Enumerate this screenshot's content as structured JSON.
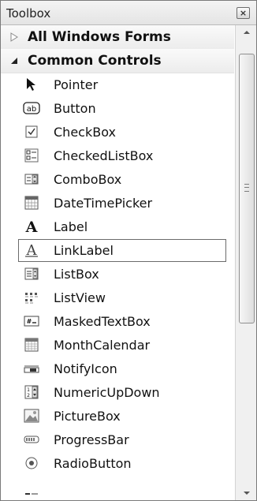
{
  "window": {
    "title": "Toolbox",
    "close_glyph": "×"
  },
  "groups": [
    {
      "label": "All Windows Forms",
      "expanded": false,
      "icon": "triangle-right-icon"
    },
    {
      "label": "Common Controls",
      "expanded": true,
      "icon": "triangle-down-icon"
    }
  ],
  "items": [
    {
      "label": "Pointer",
      "icon": "pointer-arrow-icon"
    },
    {
      "label": "Button",
      "icon": "button-ab-icon"
    },
    {
      "label": "CheckBox",
      "icon": "checkbox-icon"
    },
    {
      "label": "CheckedListBox",
      "icon": "checkedlistbox-icon"
    },
    {
      "label": "ComboBox",
      "icon": "combobox-icon"
    },
    {
      "label": "DateTimePicker",
      "icon": "datetimepicker-icon"
    },
    {
      "label": "Label",
      "icon": "label-A-icon"
    },
    {
      "label": "LinkLabel",
      "icon": "linklabel-A-icon"
    },
    {
      "label": "ListBox",
      "icon": "listbox-icon"
    },
    {
      "label": "ListView",
      "icon": "listview-icon"
    },
    {
      "label": "MaskedTextBox",
      "icon": "maskedtextbox-icon"
    },
    {
      "label": "MonthCalendar",
      "icon": "monthcalendar-icon"
    },
    {
      "label": "NotifyIcon",
      "icon": "notifyicon-icon"
    },
    {
      "label": "NumericUpDown",
      "icon": "numericupdown-icon"
    },
    {
      "label": "PictureBox",
      "icon": "picturebox-icon"
    },
    {
      "label": "ProgressBar",
      "icon": "progressbar-icon"
    },
    {
      "label": "RadioButton",
      "icon": "radiobutton-icon"
    }
  ],
  "selected_item": "LinkLabel",
  "colors": {
    "text": "#111111",
    "border": "#6b6b6b",
    "header_bg": "#ececec"
  }
}
